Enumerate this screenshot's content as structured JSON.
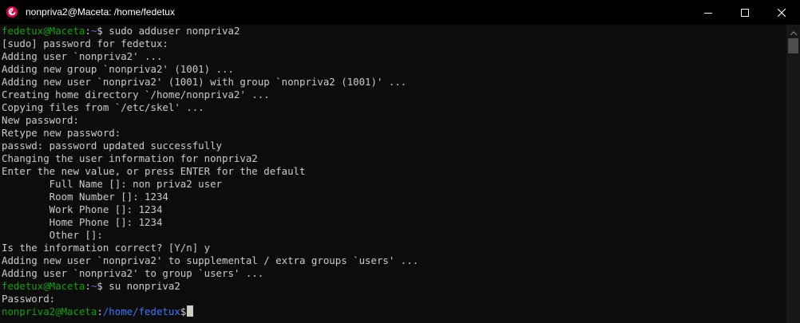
{
  "window": {
    "title": "nonpriva2@Maceta: /home/fedetux",
    "icon": "debian-swirl-icon",
    "controls": [
      "minimize-icon",
      "maximize-icon",
      "close-icon"
    ]
  },
  "colors": {
    "background": "#0c0c0c",
    "text": "#cccccc",
    "prompt_user": "#13a10e",
    "prompt_path": "#3b78ff",
    "titlebar": "#000000"
  },
  "terminal": {
    "lines": [
      {
        "kind": "prompt",
        "user": "fedetux@Maceta",
        "sep": ":",
        "path": "~",
        "sym": "$ ",
        "cmd": "sudo adduser nonpriva2"
      },
      {
        "kind": "text",
        "text": "[sudo] password for fedetux:"
      },
      {
        "kind": "text",
        "text": "Adding user `nonpriva2' ..."
      },
      {
        "kind": "text",
        "text": "Adding new group `nonpriva2' (1001) ..."
      },
      {
        "kind": "text",
        "text": "Adding new user `nonpriva2' (1001) with group `nonpriva2 (1001)' ..."
      },
      {
        "kind": "text",
        "text": "Creating home directory `/home/nonpriva2' ..."
      },
      {
        "kind": "text",
        "text": "Copying files from `/etc/skel' ..."
      },
      {
        "kind": "text",
        "text": "New password:"
      },
      {
        "kind": "text",
        "text": "Retype new password:"
      },
      {
        "kind": "text",
        "text": "passwd: password updated successfully"
      },
      {
        "kind": "text",
        "text": "Changing the user information for nonpriva2"
      },
      {
        "kind": "text",
        "text": "Enter the new value, or press ENTER for the default"
      },
      {
        "kind": "text",
        "text": "        Full Name []: non priva2 user"
      },
      {
        "kind": "text",
        "text": "        Room Number []: 1234"
      },
      {
        "kind": "text",
        "text": "        Work Phone []: 1234"
      },
      {
        "kind": "text",
        "text": "        Home Phone []: 1234"
      },
      {
        "kind": "text",
        "text": "        Other []:"
      },
      {
        "kind": "text",
        "text": "Is the information correct? [Y/n] y"
      },
      {
        "kind": "text",
        "text": "Adding new user `nonpriva2' to supplemental / extra groups `users' ..."
      },
      {
        "kind": "text",
        "text": "Adding user `nonpriva2' to group `users' ..."
      },
      {
        "kind": "prompt",
        "user": "fedetux@Maceta",
        "sep": ":",
        "path": "~",
        "sym": "$ ",
        "cmd": "su nonpriva2"
      },
      {
        "kind": "text",
        "text": "Password:"
      },
      {
        "kind": "prompt",
        "user": "nonpriva2@Maceta",
        "sep": ":",
        "path": "/home/fedetux",
        "sym": "$",
        "cmd": "",
        "cursor": true
      }
    ]
  }
}
